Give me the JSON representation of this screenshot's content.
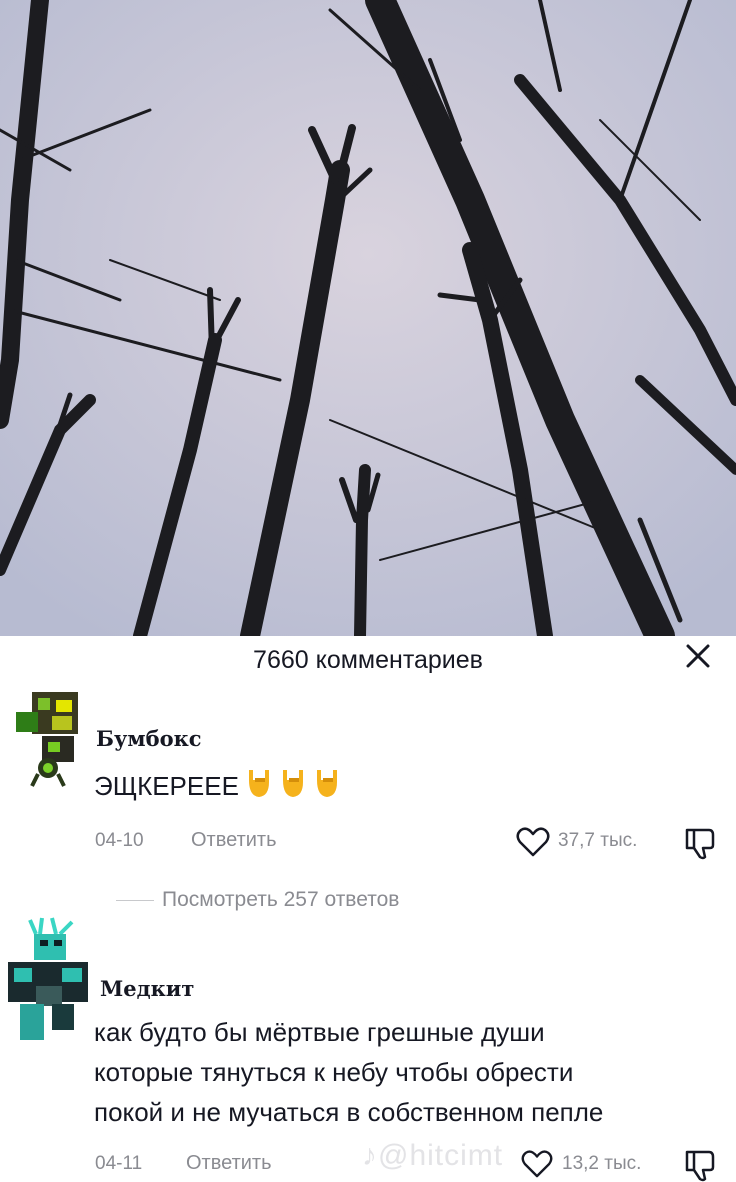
{
  "header": {
    "title": "7660 комментариев",
    "close_icon": "close-icon"
  },
  "comments": [
    {
      "author": "Бумбокс",
      "text": "ЭЩКЕРЕЕЕ",
      "emoji": [
        "rock-on-hand",
        "rock-on-hand",
        "rock-on-hand"
      ],
      "date": "04-10",
      "reply_label": "Ответить",
      "likes": "37,7 тыс.",
      "view_replies": "Посмотреть 257 ответов"
    },
    {
      "author": "Медкит",
      "text_lines": [
        "как будто бы мёртвые грешные души",
        "которые тянуться к небу чтобы обрести",
        "покой и не мучаться в собственном пепле"
      ],
      "date": "04-11",
      "reply_label": "Ответить",
      "likes": "13,2 тыс."
    }
  ],
  "watermark": "@hitcimt",
  "colors": {
    "text": "#161823",
    "secondary": "#8a8b91",
    "emoji": "#f5b21c"
  }
}
